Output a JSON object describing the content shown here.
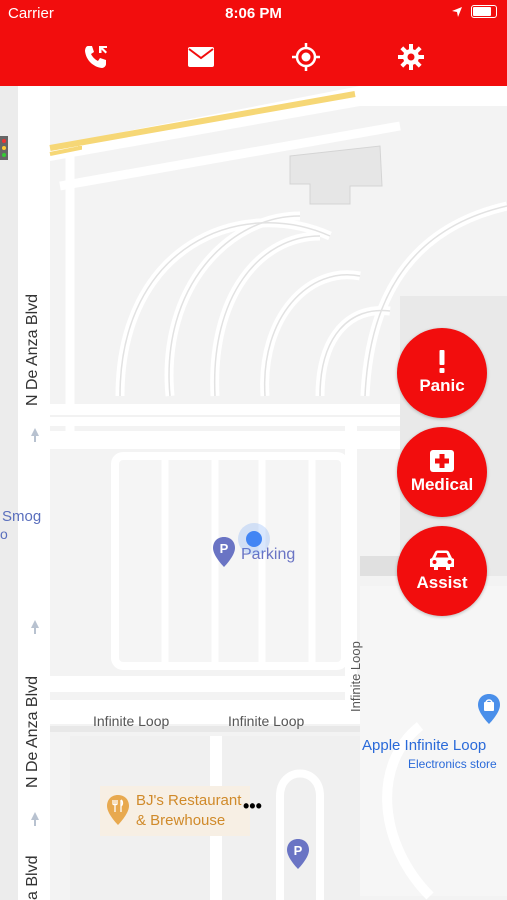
{
  "status_bar": {
    "carrier": "Carrier",
    "time": "8:06 PM"
  },
  "toolbar": {
    "icons": [
      "phone-icon",
      "mail-icon",
      "locate-icon",
      "gear-icon"
    ],
    "color": "#f20d0d"
  },
  "map": {
    "street_labels": {
      "de_anza_top": "N De Anza Blvd",
      "de_anza_mid": "N De Anza Blvd",
      "de_anza_bottom": "a Blvd",
      "infinite_loop_1": "Infinite Loop",
      "infinite_loop_2": "Infinite Loop",
      "infinite_loop_vertical": "Infinite Loop"
    },
    "places": {
      "smog": "Smog",
      "smog_sub": "o",
      "parking": "Parking",
      "apple_name": "Apple Infinite Loop",
      "apple_sub": "Electronics store",
      "bjs_line1": "BJ's Restaurant",
      "bjs_line2": "& Brewhouse"
    },
    "marker_letter": "P"
  },
  "actions": {
    "panic": "Panic",
    "medical": "Medical",
    "assist": "Assist"
  }
}
